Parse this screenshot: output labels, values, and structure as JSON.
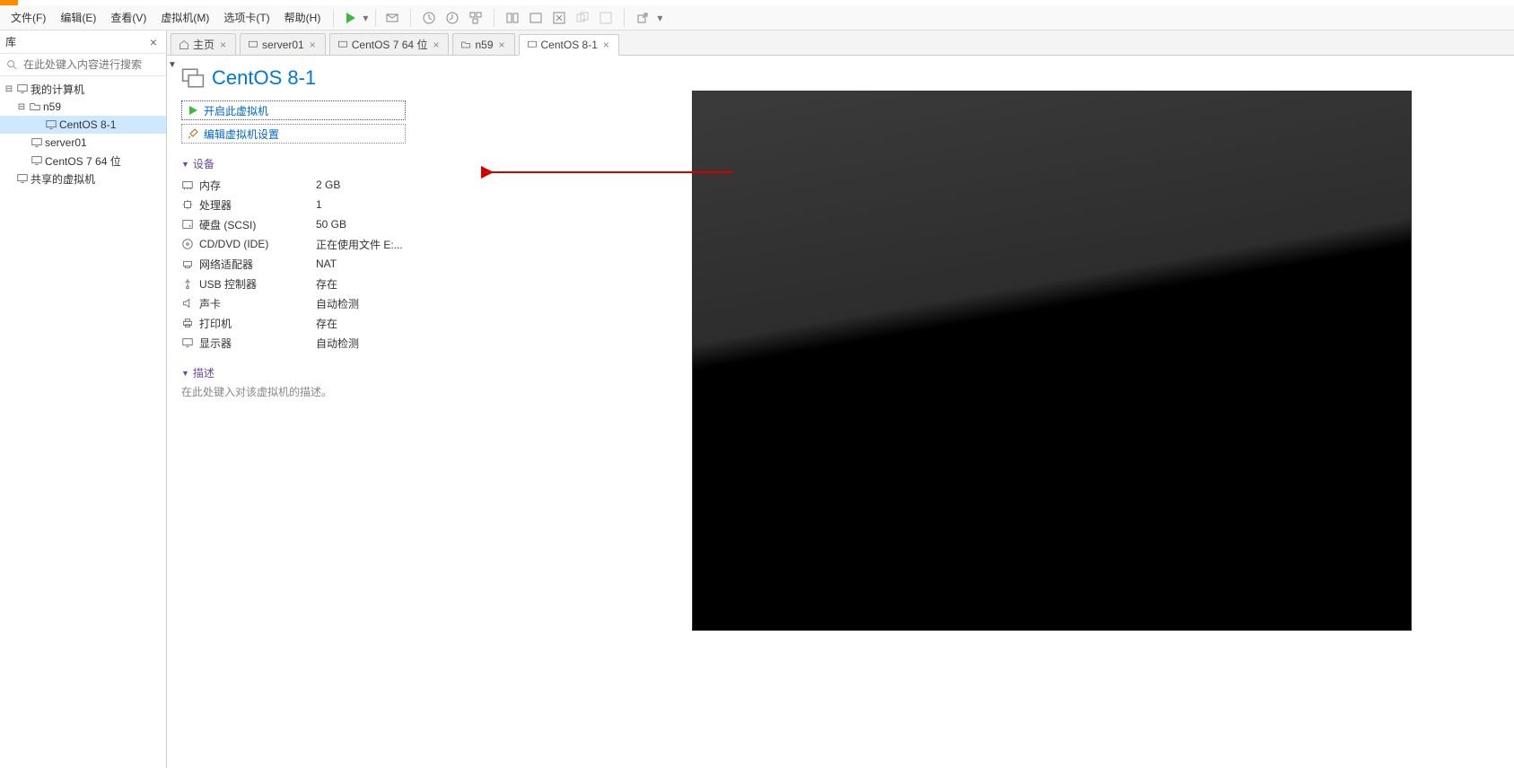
{
  "menubar": {
    "file": "文件(F)",
    "edit": "编辑(E)",
    "view": "查看(V)",
    "vm": "虚拟机(M)",
    "tabs": "选项卡(T)",
    "help": "帮助(H)"
  },
  "sidebar": {
    "title": "库",
    "search_placeholder": "在此处键入内容进行搜索",
    "tree": {
      "my_computer": "我的计算机",
      "n59": "n59",
      "centos8": "CentOS 8-1",
      "server01": "server01",
      "centos7": "CentOS 7 64 位",
      "shared": "共享的虚拟机"
    }
  },
  "tabs": {
    "home": "主页",
    "server01": "server01",
    "centos7": "CentOS 7 64 位",
    "n59": "n59",
    "centos8": "CentOS 8-1"
  },
  "page": {
    "title": "CentOS 8-1",
    "action_start": "开启此虚拟机",
    "action_edit": "编辑虚拟机设置",
    "devices_header": "设备",
    "devices": [
      {
        "label": "内存",
        "value": "2 GB",
        "icon": "memory"
      },
      {
        "label": "处理器",
        "value": "1",
        "icon": "cpu"
      },
      {
        "label": "硬盘 (SCSI)",
        "value": "50 GB",
        "icon": "disk"
      },
      {
        "label": "CD/DVD (IDE)",
        "value": "正在使用文件 E:...",
        "icon": "cd"
      },
      {
        "label": "网络适配器",
        "value": "NAT",
        "icon": "net"
      },
      {
        "label": "USB 控制器",
        "value": "存在",
        "icon": "usb"
      },
      {
        "label": "声卡",
        "value": "自动检测",
        "icon": "sound"
      },
      {
        "label": "打印机",
        "value": "存在",
        "icon": "printer"
      },
      {
        "label": "显示器",
        "value": "自动检测",
        "icon": "display"
      }
    ],
    "desc_header": "描述",
    "desc_placeholder": "在此处键入对该虚拟机的描述。"
  }
}
